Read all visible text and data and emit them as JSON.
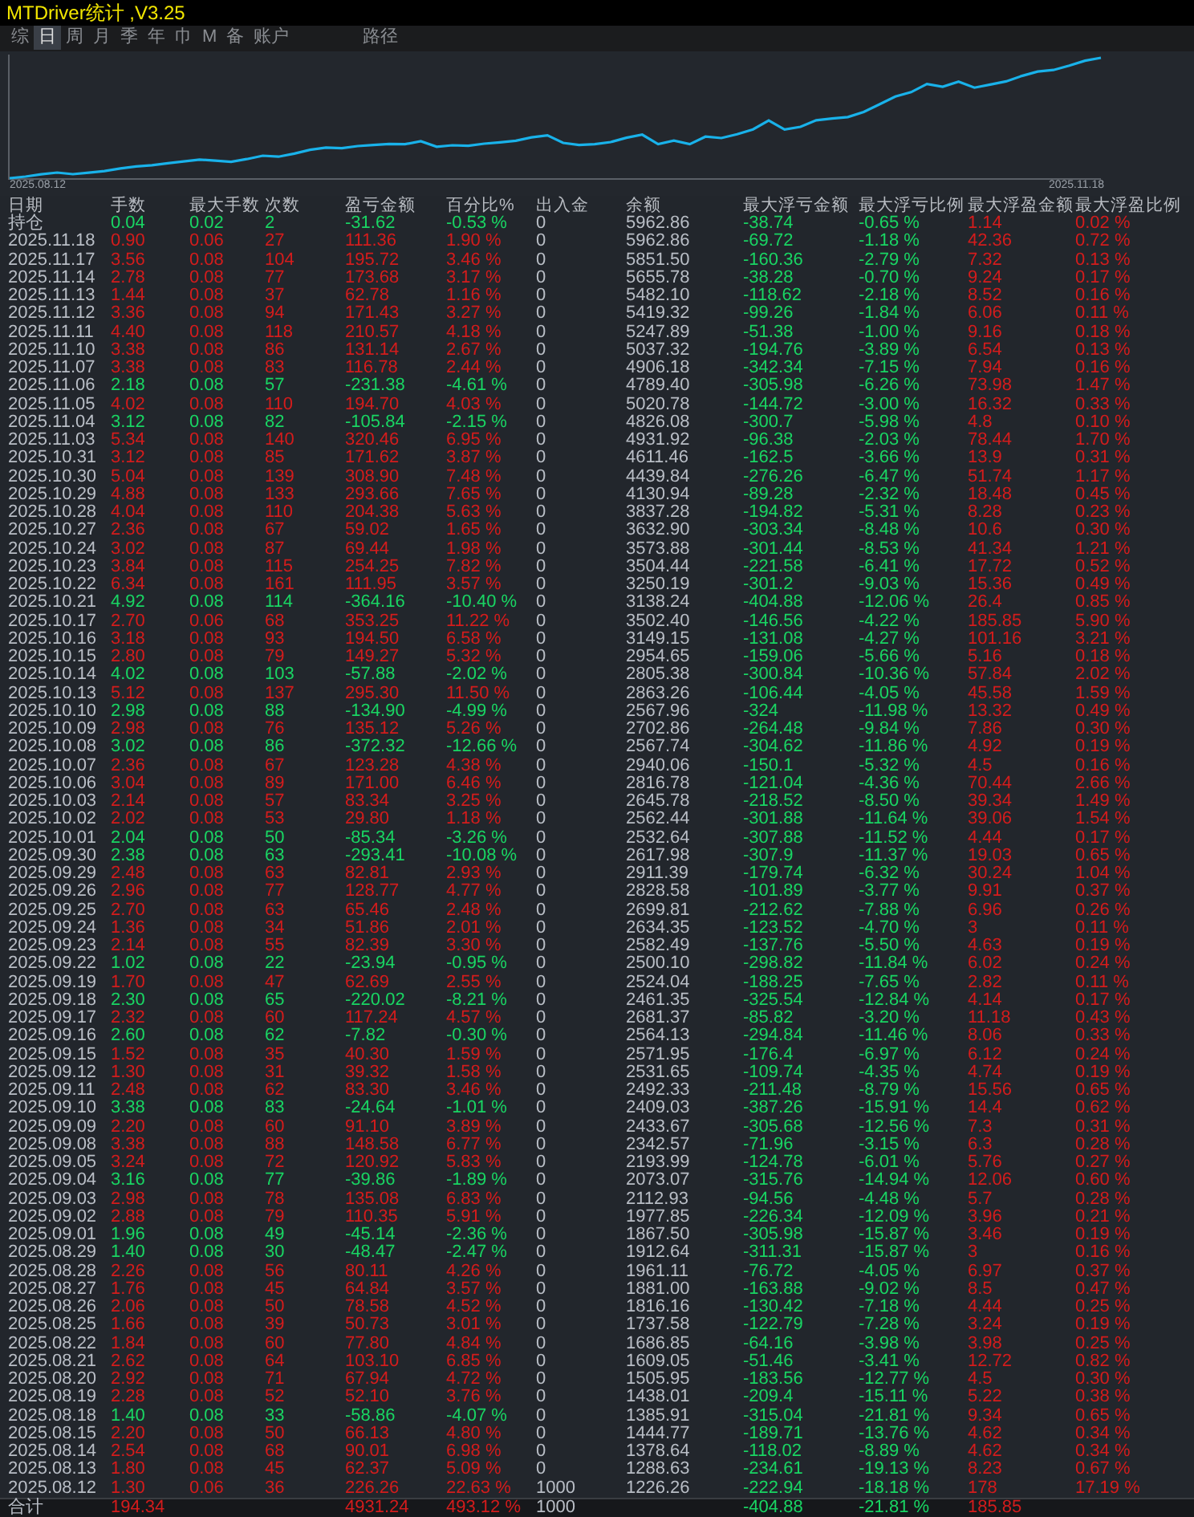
{
  "window": {
    "title": "MTDriver统计 ,V3.25"
  },
  "tabs": [
    {
      "label": "综",
      "selected": false
    },
    {
      "label": "日",
      "selected": true
    },
    {
      "label": "周",
      "selected": false
    },
    {
      "label": "月",
      "selected": false
    },
    {
      "label": "季",
      "selected": false
    },
    {
      "label": "年",
      "selected": false
    },
    {
      "label": "巾",
      "selected": false
    },
    {
      "label": "M",
      "selected": false
    },
    {
      "label": "备",
      "selected": false
    },
    {
      "label": "账户",
      "selected": false
    },
    {
      "label": "路径",
      "selected": false
    }
  ],
  "chart": {
    "start_label": "2025.08.12",
    "end_label": "2025.11.18"
  },
  "table": {
    "columns": [
      "日期",
      "手数",
      "最大手数",
      "次数",
      "盈亏金额",
      "百分比%",
      "出入金",
      "余额",
      "最大浮亏金额",
      "最大浮亏比例",
      "最大浮盈金额",
      "最大浮盈比例"
    ],
    "rows": [
      {
        "kind": "position",
        "gain": false,
        "cells": [
          "持仓",
          "0.04",
          "0.02",
          "2",
          "-31.62",
          "-0.53 %",
          "0",
          "5962.86",
          "-38.74",
          "-0.65 %",
          "1.14",
          "0.02 %"
        ]
      },
      {
        "kind": "day",
        "gain": true,
        "cells": [
          "2025.11.18",
          "0.90",
          "0.06",
          "27",
          "111.36",
          "1.90 %",
          "0",
          "5962.86",
          "-69.72",
          "-1.18 %",
          "42.36",
          "0.72 %"
        ]
      },
      {
        "kind": "day",
        "gain": true,
        "cells": [
          "2025.11.17",
          "3.56",
          "0.08",
          "104",
          "195.72",
          "3.46 %",
          "0",
          "5851.50",
          "-160.36",
          "-2.79 %",
          "7.32",
          "0.13 %"
        ]
      },
      {
        "kind": "day",
        "gain": true,
        "cells": [
          "2025.11.14",
          "2.78",
          "0.08",
          "77",
          "173.68",
          "3.17 %",
          "0",
          "5655.78",
          "-38.28",
          "-0.70 %",
          "9.24",
          "0.17 %"
        ]
      },
      {
        "kind": "day",
        "gain": true,
        "cells": [
          "2025.11.13",
          "1.44",
          "0.08",
          "37",
          "62.78",
          "1.16 %",
          "0",
          "5482.10",
          "-118.62",
          "-2.18 %",
          "8.52",
          "0.16 %"
        ]
      },
      {
        "kind": "day",
        "gain": true,
        "cells": [
          "2025.11.12",
          "3.36",
          "0.08",
          "94",
          "171.43",
          "3.27 %",
          "0",
          "5419.32",
          "-99.26",
          "-1.84 %",
          "6.06",
          "0.11 %"
        ]
      },
      {
        "kind": "day",
        "gain": true,
        "cells": [
          "2025.11.11",
          "4.40",
          "0.08",
          "118",
          "210.57",
          "4.18 %",
          "0",
          "5247.89",
          "-51.38",
          "-1.00 %",
          "9.16",
          "0.18 %"
        ]
      },
      {
        "kind": "day",
        "gain": true,
        "cells": [
          "2025.11.10",
          "3.38",
          "0.08",
          "86",
          "131.14",
          "2.67 %",
          "0",
          "5037.32",
          "-194.76",
          "-3.89 %",
          "6.54",
          "0.13 %"
        ]
      },
      {
        "kind": "day",
        "gain": true,
        "cells": [
          "2025.11.07",
          "3.38",
          "0.08",
          "83",
          "116.78",
          "2.44 %",
          "0",
          "4906.18",
          "-342.34",
          "-7.15 %",
          "7.94",
          "0.16 %"
        ]
      },
      {
        "kind": "day",
        "gain": false,
        "cells": [
          "2025.11.06",
          "2.18",
          "0.08",
          "57",
          "-231.38",
          "-4.61 %",
          "0",
          "4789.40",
          "-305.98",
          "-6.26 %",
          "73.98",
          "1.47 %"
        ]
      },
      {
        "kind": "day",
        "gain": true,
        "cells": [
          "2025.11.05",
          "4.02",
          "0.08",
          "110",
          "194.70",
          "4.03 %",
          "0",
          "5020.78",
          "-144.72",
          "-3.00 %",
          "16.32",
          "0.33 %"
        ]
      },
      {
        "kind": "day",
        "gain": false,
        "cells": [
          "2025.11.04",
          "3.12",
          "0.08",
          "82",
          "-105.84",
          "-2.15 %",
          "0",
          "4826.08",
          "-300.7",
          "-5.98 %",
          "4.8",
          "0.10 %"
        ]
      },
      {
        "kind": "day",
        "gain": true,
        "cells": [
          "2025.11.03",
          "5.34",
          "0.08",
          "140",
          "320.46",
          "6.95 %",
          "0",
          "4931.92",
          "-96.38",
          "-2.03 %",
          "78.44",
          "1.70 %"
        ]
      },
      {
        "kind": "day",
        "gain": true,
        "cells": [
          "2025.10.31",
          "3.12",
          "0.08",
          "85",
          "171.62",
          "3.87 %",
          "0",
          "4611.46",
          "-162.5",
          "-3.66 %",
          "13.9",
          "0.31 %"
        ]
      },
      {
        "kind": "day",
        "gain": true,
        "cells": [
          "2025.10.30",
          "5.04",
          "0.08",
          "139",
          "308.90",
          "7.48 %",
          "0",
          "4439.84",
          "-276.26",
          "-6.47 %",
          "51.74",
          "1.17 %"
        ]
      },
      {
        "kind": "day",
        "gain": true,
        "cells": [
          "2025.10.29",
          "4.88",
          "0.08",
          "133",
          "293.66",
          "7.65 %",
          "0",
          "4130.94",
          "-89.28",
          "-2.32 %",
          "18.48",
          "0.45 %"
        ]
      },
      {
        "kind": "day",
        "gain": true,
        "cells": [
          "2025.10.28",
          "4.04",
          "0.08",
          "110",
          "204.38",
          "5.63 %",
          "0",
          "3837.28",
          "-194.82",
          "-5.31 %",
          "8.28",
          "0.23 %"
        ]
      },
      {
        "kind": "day",
        "gain": true,
        "cells": [
          "2025.10.27",
          "2.36",
          "0.08",
          "67",
          "59.02",
          "1.65 %",
          "0",
          "3632.90",
          "-303.34",
          "-8.48 %",
          "10.6",
          "0.30 %"
        ]
      },
      {
        "kind": "day",
        "gain": true,
        "cells": [
          "2025.10.24",
          "3.02",
          "0.08",
          "87",
          "69.44",
          "1.98 %",
          "0",
          "3573.88",
          "-301.44",
          "-8.53 %",
          "41.34",
          "1.21 %"
        ]
      },
      {
        "kind": "day",
        "gain": true,
        "cells": [
          "2025.10.23",
          "3.84",
          "0.08",
          "115",
          "254.25",
          "7.82 %",
          "0",
          "3504.44",
          "-221.58",
          "-6.41 %",
          "17.72",
          "0.52 %"
        ]
      },
      {
        "kind": "day",
        "gain": true,
        "cells": [
          "2025.10.22",
          "6.34",
          "0.08",
          "161",
          "111.95",
          "3.57 %",
          "0",
          "3250.19",
          "-301.2",
          "-9.03 %",
          "15.36",
          "0.49 %"
        ]
      },
      {
        "kind": "day",
        "gain": false,
        "cells": [
          "2025.10.21",
          "4.92",
          "0.08",
          "114",
          "-364.16",
          "-10.40 %",
          "0",
          "3138.24",
          "-404.88",
          "-12.06 %",
          "26.4",
          "0.85 %"
        ]
      },
      {
        "kind": "day",
        "gain": true,
        "cells": [
          "2025.10.17",
          "2.70",
          "0.06",
          "68",
          "353.25",
          "11.22 %",
          "0",
          "3502.40",
          "-146.56",
          "-4.22 %",
          "185.85",
          "5.90 %"
        ]
      },
      {
        "kind": "day",
        "gain": true,
        "cells": [
          "2025.10.16",
          "3.18",
          "0.08",
          "93",
          "194.50",
          "6.58 %",
          "0",
          "3149.15",
          "-131.08",
          "-4.27 %",
          "101.16",
          "3.21 %"
        ]
      },
      {
        "kind": "day",
        "gain": true,
        "cells": [
          "2025.10.15",
          "2.80",
          "0.08",
          "79",
          "149.27",
          "5.32 %",
          "0",
          "2954.65",
          "-159.06",
          "-5.66 %",
          "5.16",
          "0.18 %"
        ]
      },
      {
        "kind": "day",
        "gain": false,
        "cells": [
          "2025.10.14",
          "4.02",
          "0.08",
          "103",
          "-57.88",
          "-2.02 %",
          "0",
          "2805.38",
          "-300.84",
          "-10.36 %",
          "57.84",
          "2.02 %"
        ]
      },
      {
        "kind": "day",
        "gain": true,
        "cells": [
          "2025.10.13",
          "5.12",
          "0.08",
          "137",
          "295.30",
          "11.50 %",
          "0",
          "2863.26",
          "-106.44",
          "-4.05 %",
          "45.58",
          "1.59 %"
        ]
      },
      {
        "kind": "day",
        "gain": false,
        "cells": [
          "2025.10.10",
          "2.98",
          "0.08",
          "88",
          "-134.90",
          "-4.99 %",
          "0",
          "2567.96",
          "-324",
          "-11.98 %",
          "13.32",
          "0.49 %"
        ]
      },
      {
        "kind": "day",
        "gain": true,
        "cells": [
          "2025.10.09",
          "2.98",
          "0.08",
          "76",
          "135.12",
          "5.26 %",
          "0",
          "2702.86",
          "-264.48",
          "-9.84 %",
          "7.86",
          "0.30 %"
        ]
      },
      {
        "kind": "day",
        "gain": false,
        "cells": [
          "2025.10.08",
          "3.02",
          "0.08",
          "86",
          "-372.32",
          "-12.66 %",
          "0",
          "2567.74",
          "-304.62",
          "-11.86 %",
          "4.92",
          "0.19 %"
        ]
      },
      {
        "kind": "day",
        "gain": true,
        "cells": [
          "2025.10.07",
          "2.36",
          "0.08",
          "67",
          "123.28",
          "4.38 %",
          "0",
          "2940.06",
          "-150.1",
          "-5.32 %",
          "4.5",
          "0.16 %"
        ]
      },
      {
        "kind": "day",
        "gain": true,
        "cells": [
          "2025.10.06",
          "3.04",
          "0.08",
          "89",
          "171.00",
          "6.46 %",
          "0",
          "2816.78",
          "-121.04",
          "-4.36 %",
          "70.44",
          "2.66 %"
        ]
      },
      {
        "kind": "day",
        "gain": true,
        "cells": [
          "2025.10.03",
          "2.14",
          "0.08",
          "57",
          "83.34",
          "3.25 %",
          "0",
          "2645.78",
          "-218.52",
          "-8.50 %",
          "39.34",
          "1.49 %"
        ]
      },
      {
        "kind": "day",
        "gain": true,
        "cells": [
          "2025.10.02",
          "2.02",
          "0.08",
          "53",
          "29.80",
          "1.18 %",
          "0",
          "2562.44",
          "-301.88",
          "-11.64 %",
          "39.06",
          "1.54 %"
        ]
      },
      {
        "kind": "day",
        "gain": false,
        "cells": [
          "2025.10.01",
          "2.04",
          "0.08",
          "50",
          "-85.34",
          "-3.26 %",
          "0",
          "2532.64",
          "-307.88",
          "-11.52 %",
          "4.44",
          "0.17 %"
        ]
      },
      {
        "kind": "day",
        "gain": false,
        "cells": [
          "2025.09.30",
          "2.38",
          "0.08",
          "63",
          "-293.41",
          "-10.08 %",
          "0",
          "2617.98",
          "-307.9",
          "-11.37 %",
          "19.03",
          "0.65 %"
        ]
      },
      {
        "kind": "day",
        "gain": true,
        "cells": [
          "2025.09.29",
          "2.48",
          "0.08",
          "63",
          "82.81",
          "2.93 %",
          "0",
          "2911.39",
          "-179.74",
          "-6.32 %",
          "30.24",
          "1.04 %"
        ]
      },
      {
        "kind": "day",
        "gain": true,
        "cells": [
          "2025.09.26",
          "2.96",
          "0.08",
          "77",
          "128.77",
          "4.77 %",
          "0",
          "2828.58",
          "-101.89",
          "-3.77 %",
          "9.91",
          "0.37 %"
        ]
      },
      {
        "kind": "day",
        "gain": true,
        "cells": [
          "2025.09.25",
          "2.70",
          "0.08",
          "63",
          "65.46",
          "2.48 %",
          "0",
          "2699.81",
          "-212.62",
          "-7.88 %",
          "6.96",
          "0.26 %"
        ]
      },
      {
        "kind": "day",
        "gain": true,
        "cells": [
          "2025.09.24",
          "1.36",
          "0.08",
          "34",
          "51.86",
          "2.01 %",
          "0",
          "2634.35",
          "-123.52",
          "-4.70 %",
          "3",
          "0.11 %"
        ]
      },
      {
        "kind": "day",
        "gain": true,
        "cells": [
          "2025.09.23",
          "2.14",
          "0.08",
          "55",
          "82.39",
          "3.30 %",
          "0",
          "2582.49",
          "-137.76",
          "-5.50 %",
          "4.63",
          "0.19 %"
        ]
      },
      {
        "kind": "day",
        "gain": false,
        "cells": [
          "2025.09.22",
          "1.02",
          "0.08",
          "22",
          "-23.94",
          "-0.95 %",
          "0",
          "2500.10",
          "-298.82",
          "-11.84 %",
          "6.02",
          "0.24 %"
        ]
      },
      {
        "kind": "day",
        "gain": true,
        "cells": [
          "2025.09.19",
          "1.70",
          "0.08",
          "47",
          "62.69",
          "2.55 %",
          "0",
          "2524.04",
          "-188.25",
          "-7.65 %",
          "2.82",
          "0.11 %"
        ]
      },
      {
        "kind": "day",
        "gain": false,
        "cells": [
          "2025.09.18",
          "2.30",
          "0.08",
          "65",
          "-220.02",
          "-8.21 %",
          "0",
          "2461.35",
          "-325.54",
          "-12.84 %",
          "4.14",
          "0.17 %"
        ]
      },
      {
        "kind": "day",
        "gain": true,
        "cells": [
          "2025.09.17",
          "2.32",
          "0.08",
          "60",
          "117.24",
          "4.57 %",
          "0",
          "2681.37",
          "-85.82",
          "-3.20 %",
          "11.18",
          "0.43 %"
        ]
      },
      {
        "kind": "day",
        "gain": false,
        "cells": [
          "2025.09.16",
          "2.60",
          "0.08",
          "62",
          "-7.82",
          "-0.30 %",
          "0",
          "2564.13",
          "-294.84",
          "-11.46 %",
          "8.06",
          "0.33 %"
        ]
      },
      {
        "kind": "day",
        "gain": true,
        "cells": [
          "2025.09.15",
          "1.52",
          "0.08",
          "35",
          "40.30",
          "1.59 %",
          "0",
          "2571.95",
          "-176.4",
          "-6.97 %",
          "6.12",
          "0.24 %"
        ]
      },
      {
        "kind": "day",
        "gain": true,
        "cells": [
          "2025.09.12",
          "1.30",
          "0.08",
          "31",
          "39.32",
          "1.58 %",
          "0",
          "2531.65",
          "-109.74",
          "-4.35 %",
          "4.74",
          "0.19 %"
        ]
      },
      {
        "kind": "day",
        "gain": true,
        "cells": [
          "2025.09.11",
          "2.48",
          "0.08",
          "62",
          "83.30",
          "3.46 %",
          "0",
          "2492.33",
          "-211.48",
          "-8.79 %",
          "15.56",
          "0.65 %"
        ]
      },
      {
        "kind": "day",
        "gain": false,
        "cells": [
          "2025.09.10",
          "3.38",
          "0.08",
          "83",
          "-24.64",
          "-1.01 %",
          "0",
          "2409.03",
          "-387.26",
          "-15.91 %",
          "14.4",
          "0.62 %"
        ]
      },
      {
        "kind": "day",
        "gain": true,
        "cells": [
          "2025.09.09",
          "2.20",
          "0.08",
          "60",
          "91.10",
          "3.89 %",
          "0",
          "2433.67",
          "-305.68",
          "-12.56 %",
          "7.3",
          "0.31 %"
        ]
      },
      {
        "kind": "day",
        "gain": true,
        "cells": [
          "2025.09.08",
          "3.38",
          "0.08",
          "88",
          "148.58",
          "6.77 %",
          "0",
          "2342.57",
          "-71.96",
          "-3.15 %",
          "6.3",
          "0.28 %"
        ]
      },
      {
        "kind": "day",
        "gain": true,
        "cells": [
          "2025.09.05",
          "3.24",
          "0.08",
          "72",
          "120.92",
          "5.83 %",
          "0",
          "2193.99",
          "-124.78",
          "-6.01 %",
          "5.76",
          "0.27 %"
        ]
      },
      {
        "kind": "day",
        "gain": false,
        "cells": [
          "2025.09.04",
          "3.16",
          "0.08",
          "77",
          "-39.86",
          "-1.89 %",
          "0",
          "2073.07",
          "-315.76",
          "-14.94 %",
          "12.06",
          "0.60 %"
        ]
      },
      {
        "kind": "day",
        "gain": true,
        "cells": [
          "2025.09.03",
          "2.98",
          "0.08",
          "78",
          "135.08",
          "6.83 %",
          "0",
          "2112.93",
          "-94.56",
          "-4.48 %",
          "5.7",
          "0.28 %"
        ]
      },
      {
        "kind": "day",
        "gain": true,
        "cells": [
          "2025.09.02",
          "2.88",
          "0.08",
          "79",
          "110.35",
          "5.91 %",
          "0",
          "1977.85",
          "-226.34",
          "-12.09 %",
          "3.96",
          "0.21 %"
        ]
      },
      {
        "kind": "day",
        "gain": false,
        "cells": [
          "2025.09.01",
          "1.96",
          "0.08",
          "49",
          "-45.14",
          "-2.36 %",
          "0",
          "1867.50",
          "-305.98",
          "-15.87 %",
          "3.46",
          "0.19 %"
        ]
      },
      {
        "kind": "day",
        "gain": false,
        "cells": [
          "2025.08.29",
          "1.40",
          "0.08",
          "30",
          "-48.47",
          "-2.47 %",
          "0",
          "1912.64",
          "-311.31",
          "-15.87 %",
          "3",
          "0.16 %"
        ]
      },
      {
        "kind": "day",
        "gain": true,
        "cells": [
          "2025.08.28",
          "2.26",
          "0.08",
          "56",
          "80.11",
          "4.26 %",
          "0",
          "1961.11",
          "-76.72",
          "-4.05 %",
          "6.97",
          "0.37 %"
        ]
      },
      {
        "kind": "day",
        "gain": true,
        "cells": [
          "2025.08.27",
          "1.76",
          "0.08",
          "45",
          "64.84",
          "3.57 %",
          "0",
          "1881.00",
          "-163.88",
          "-9.02 %",
          "8.5",
          "0.47 %"
        ]
      },
      {
        "kind": "day",
        "gain": true,
        "cells": [
          "2025.08.26",
          "2.06",
          "0.08",
          "50",
          "78.58",
          "4.52 %",
          "0",
          "1816.16",
          "-130.42",
          "-7.18 %",
          "4.44",
          "0.25 %"
        ]
      },
      {
        "kind": "day",
        "gain": true,
        "cells": [
          "2025.08.25",
          "1.66",
          "0.08",
          "39",
          "50.73",
          "3.01 %",
          "0",
          "1737.58",
          "-122.79",
          "-7.28 %",
          "3.24",
          "0.19 %"
        ]
      },
      {
        "kind": "day",
        "gain": true,
        "cells": [
          "2025.08.22",
          "1.84",
          "0.08",
          "60",
          "77.80",
          "4.84 %",
          "0",
          "1686.85",
          "-64.16",
          "-3.98 %",
          "3.98",
          "0.25 %"
        ]
      },
      {
        "kind": "day",
        "gain": true,
        "cells": [
          "2025.08.21",
          "2.62",
          "0.08",
          "64",
          "103.10",
          "6.85 %",
          "0",
          "1609.05",
          "-51.46",
          "-3.41 %",
          "12.72",
          "0.82 %"
        ]
      },
      {
        "kind": "day",
        "gain": true,
        "cells": [
          "2025.08.20",
          "2.92",
          "0.08",
          "71",
          "67.94",
          "4.72 %",
          "0",
          "1505.95",
          "-183.56",
          "-12.77 %",
          "4.5",
          "0.30 %"
        ]
      },
      {
        "kind": "day",
        "gain": true,
        "cells": [
          "2025.08.19",
          "2.28",
          "0.08",
          "52",
          "52.10",
          "3.76 %",
          "0",
          "1438.01",
          "-209.4",
          "-15.11 %",
          "5.22",
          "0.38 %"
        ]
      },
      {
        "kind": "day",
        "gain": false,
        "cells": [
          "2025.08.18",
          "1.40",
          "0.08",
          "33",
          "-58.86",
          "-4.07 %",
          "0",
          "1385.91",
          "-315.04",
          "-21.81 %",
          "9.34",
          "0.65 %"
        ]
      },
      {
        "kind": "day",
        "gain": true,
        "cells": [
          "2025.08.15",
          "2.20",
          "0.08",
          "50",
          "66.13",
          "4.80 %",
          "0",
          "1444.77",
          "-189.71",
          "-13.76 %",
          "4.62",
          "0.34 %"
        ]
      },
      {
        "kind": "day",
        "gain": true,
        "cells": [
          "2025.08.14",
          "2.54",
          "0.08",
          "68",
          "90.01",
          "6.98 %",
          "0",
          "1378.64",
          "-118.02",
          "-8.89 %",
          "4.62",
          "0.34 %"
        ]
      },
      {
        "kind": "day",
        "gain": true,
        "cells": [
          "2025.08.13",
          "1.80",
          "0.08",
          "45",
          "62.37",
          "5.09 %",
          "0",
          "1288.63",
          "-234.61",
          "-19.13 %",
          "8.23",
          "0.67 %"
        ]
      },
      {
        "kind": "day",
        "gain": true,
        "cells": [
          "2025.08.12",
          "1.30",
          "0.06",
          "36",
          "226.26",
          "22.63 %",
          "1000",
          "1226.26",
          "-222.94",
          "-18.18 %",
          "178",
          "17.19 %"
        ]
      },
      {
        "kind": "total",
        "gain": true,
        "cells": [
          "合计",
          "194.34",
          null,
          null,
          "4931.24",
          "493.12 %",
          "1000",
          null,
          "-404.88",
          "-21.81 %",
          "185.85",
          null
        ]
      }
    ]
  }
}
